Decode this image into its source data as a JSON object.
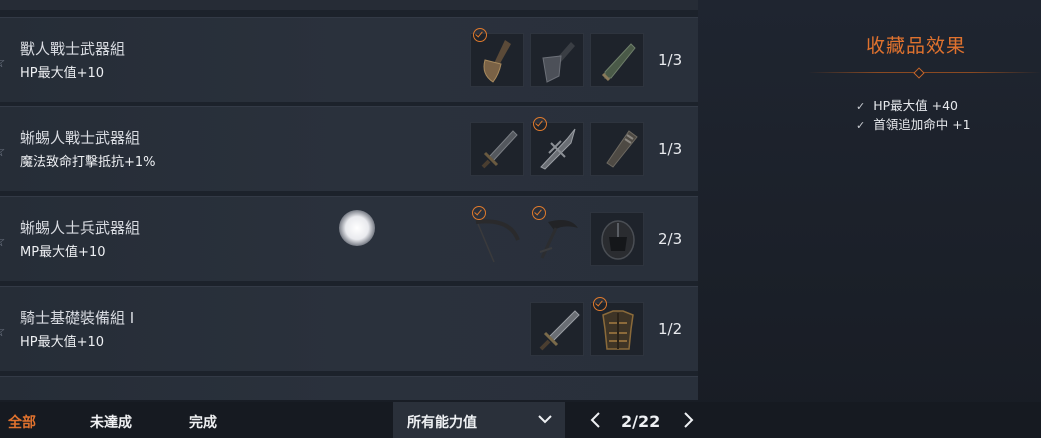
{
  "collections": [
    {
      "name": "獸人戰士武器組",
      "effect": "HP最大值+10",
      "progress": "1/3",
      "items": [
        {
          "icon": "orc-axe-icon",
          "collected": true
        },
        {
          "icon": "orc-cleaver-icon",
          "collected": false
        },
        {
          "icon": "orc-dagger-icon",
          "collected": false
        }
      ]
    },
    {
      "name": "蜥蜴人戰士武器組",
      "effect": "魔法致命打擊抵抗+1%",
      "progress": "1/3",
      "items": [
        {
          "icon": "lizardman-sword-icon",
          "collected": false
        },
        {
          "icon": "lizardman-spear-icon",
          "collected": true
        },
        {
          "icon": "lizardman-club-icon",
          "collected": false
        }
      ]
    },
    {
      "name": "蜥蜴人士兵武器組",
      "effect": "MP最大值+10",
      "progress": "2/3",
      "items": [
        {
          "icon": "lizardman-bow-icon",
          "collected": true
        },
        {
          "icon": "lizardman-scythe-icon",
          "collected": true
        },
        {
          "icon": "lizardman-helmet-icon",
          "collected": false
        }
      ]
    },
    {
      "name": "騎士基礎裝備組 I",
      "effect": "HP最大值+10",
      "progress": "1/2",
      "items": [
        {
          "icon": "knight-sword-icon",
          "collected": false
        },
        {
          "icon": "knight-armor-icon",
          "collected": true
        }
      ]
    }
  ],
  "panel": {
    "title": "收藏品效果",
    "effects": [
      "HP最大值 +40",
      "首領追加命中 +1"
    ]
  },
  "filters": {
    "all": "全部",
    "incomplete": "未達成",
    "complete": "完成",
    "active": "all"
  },
  "stat_select": {
    "value": "所有能力值"
  },
  "pager": {
    "text": "2/22"
  },
  "colors": {
    "accent": "#e0722e",
    "check": "#e07a2c"
  }
}
